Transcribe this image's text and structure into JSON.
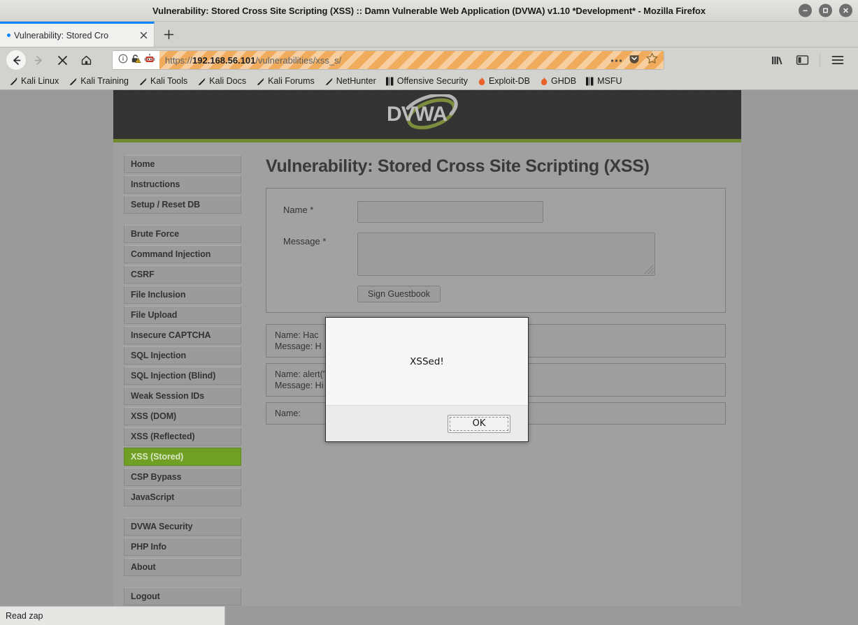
{
  "window": {
    "title": "Vulnerability: Stored Cross Site Scripting (XSS) :: Damn Vulnerable Web Application (DVWA) v1.10 *Development* - Mozilla Firefox",
    "controls": [
      {
        "name": "minimize",
        "glyph": "minimize-icon"
      },
      {
        "name": "maximize",
        "glyph": "maximize-icon"
      },
      {
        "name": "close",
        "glyph": "close-icon"
      }
    ]
  },
  "tabs": {
    "active_tab_title": "Vulnerability: Stored Cro",
    "new_tab_label": "+"
  },
  "nav": {
    "back": "back-arrow-icon",
    "forward": "forward-arrow-icon",
    "stop": "stop-icon",
    "home": "home-icon",
    "library": "library-icon",
    "sidebar": "sidebar-icon",
    "menu": "hamburger-menu-icon"
  },
  "urlbar": {
    "scheme": "https://",
    "host": "192.168.56.101",
    "path": "/vulnerabilities/xss_s/",
    "full_url": "https://192.168.56.101/vulnerabilities/xss_s/",
    "identity_icon": "info-circle-icon",
    "lock_warning_icon": "lock-warning-icon",
    "robot_icon": "robot-icon",
    "page_actions_icon": "ellipsis-icon",
    "pocket_icon": "pocket-icon",
    "bookmark_icon": "star-icon",
    "highlight_color": "#f0ab5c"
  },
  "bookmarks": [
    {
      "label": "Kali Linux",
      "icon": "dragon-icon"
    },
    {
      "label": "Kali Training",
      "icon": "dragon-icon"
    },
    {
      "label": "Kali Tools",
      "icon": "dragon-icon"
    },
    {
      "label": "Kali Docs",
      "icon": "dragon-icon"
    },
    {
      "label": "Kali Forums",
      "icon": "dragon-icon"
    },
    {
      "label": "NetHunter",
      "icon": "dragon-icon"
    },
    {
      "label": "Offensive Security",
      "icon": "offsec-icon"
    },
    {
      "label": "Exploit-DB",
      "icon": "flame-icon"
    },
    {
      "label": "GHDB",
      "icon": "flame-icon"
    },
    {
      "label": "MSFU",
      "icon": "offsec-icon"
    }
  ],
  "dvwa": {
    "logo_text": "DVWA",
    "accent_color": "#6fa025",
    "header_bg": "#333333",
    "sidebar_groups": [
      {
        "items": [
          {
            "label": "Home",
            "active": false
          },
          {
            "label": "Instructions",
            "active": false
          },
          {
            "label": "Setup / Reset DB",
            "active": false
          }
        ]
      },
      {
        "items": [
          {
            "label": "Brute Force",
            "active": false
          },
          {
            "label": "Command Injection",
            "active": false
          },
          {
            "label": "CSRF",
            "active": false
          },
          {
            "label": "File Inclusion",
            "active": false
          },
          {
            "label": "File Upload",
            "active": false
          },
          {
            "label": "Insecure CAPTCHA",
            "active": false
          },
          {
            "label": "SQL Injection",
            "active": false
          },
          {
            "label": "SQL Injection (Blind)",
            "active": false
          },
          {
            "label": "Weak Session IDs",
            "active": false
          },
          {
            "label": "XSS (DOM)",
            "active": false
          },
          {
            "label": "XSS (Reflected)",
            "active": false
          },
          {
            "label": "XSS (Stored)",
            "active": true
          },
          {
            "label": "CSP Bypass",
            "active": false
          },
          {
            "label": "JavaScript",
            "active": false
          }
        ]
      },
      {
        "items": [
          {
            "label": "DVWA Security",
            "active": false
          },
          {
            "label": "PHP Info",
            "active": false
          },
          {
            "label": "About",
            "active": false
          }
        ]
      },
      {
        "items": [
          {
            "label": "Logout",
            "active": false
          }
        ]
      }
    ],
    "page_title": "Vulnerability: Stored Cross Site Scripting (XSS)",
    "form": {
      "name_label": "Name *",
      "name_value": "",
      "message_label": "Message *",
      "message_value": "",
      "submit_label": "Sign Guestbook"
    },
    "guestbook": [
      {
        "name_line": "Name: Hac",
        "message_line": "Message: H"
      },
      {
        "name_line": "Name: alert(\"XSSed!\")",
        "message_line": "Message: Hi"
      },
      {
        "name_line": "Name:",
        "message_line": ""
      }
    ]
  },
  "modal": {
    "message": "XSSed!",
    "ok_label": "OK"
  },
  "statusbar": {
    "text": "Read zap"
  }
}
